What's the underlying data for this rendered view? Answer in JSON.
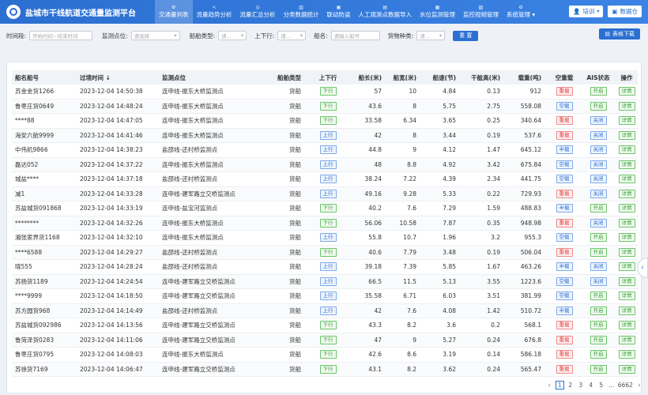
{
  "app": {
    "title": "盐城市干线航道交通量监测平台"
  },
  "nav": [
    {
      "label": "交通量列表",
      "icon": "⚙",
      "active": true
    },
    {
      "label": "流量趋势分析",
      "icon": "<"
    },
    {
      "label": "流量汇总分析",
      "icon": "◎"
    },
    {
      "label": "分类数据统计",
      "icon": "▥"
    },
    {
      "label": "联动防盗",
      "icon": "▣"
    },
    {
      "label": "人工观测点数据导入",
      "icon": "▤"
    },
    {
      "label": "水位监测管理",
      "icon": "▦"
    },
    {
      "label": "监控视频管理",
      "icon": "▧"
    },
    {
      "label": "系统管理 ▾",
      "icon": "⚙"
    }
  ],
  "user": {
    "name": "培训",
    "screen_label": "数据仓"
  },
  "filters": {
    "time_label": "时间段:",
    "time_placeholder": "开始时间~结束时间",
    "point_label": "监测点位:",
    "point_placeholder": "请选择",
    "type_label": "船舶类型:",
    "type_placeholder": "请...",
    "direction_label": "上下行:",
    "direction_placeholder": "请...",
    "ship_label": "船名:",
    "ship_placeholder": "请输入船号",
    "cargo_label": "货物种类:",
    "cargo_placeholder": "请...",
    "reset_label": "重 置",
    "export_label": "表格下载"
  },
  "table": {
    "columns": [
      "船名船号",
      "过境时间 ↓",
      "监测点位",
      "船舶类型",
      "上下行",
      "船长(米)",
      "船宽(米)",
      "船速(节)",
      "干舷高(米)",
      "载重(吨)",
      "空重载",
      "AIS状态",
      "操作"
    ],
    "rows": [
      [
        "苏金金货1266",
        "2023-12-04 14:50:38",
        "连申线-振东大桥监测点",
        "货船",
        "下行",
        "57",
        "10",
        "4.84",
        "0.13",
        "912",
        "重载",
        "开启",
        "详情"
      ],
      [
        "鲁枣庄货0649",
        "2023-12-04 14:48:24",
        "连申线-振东大桥监测点",
        "货船",
        "下行",
        "43.6",
        "8",
        "5.75",
        "2.75",
        "558.08",
        "空载",
        "开启",
        "详情"
      ],
      [
        "****88",
        "2023-12-04 14:47:05",
        "连申线-振东大桥监测点",
        "货船",
        "下行",
        "33.58",
        "6.34",
        "3.65",
        "0.25",
        "340.64",
        "重载",
        "关闭",
        "详情"
      ],
      [
        "海安六航9999",
        "2023-12-04 14:41:46",
        "连申线-振东大桥监测点",
        "货船",
        "上行",
        "42",
        "8",
        "3.44",
        "0.19",
        "537.6",
        "重载",
        "关闭",
        "详情"
      ],
      [
        "中伟机9866",
        "2023-12-04 14:38:23",
        "盐邵线-还村桥监测点",
        "货船",
        "上行",
        "44.8",
        "9",
        "4.12",
        "1.47",
        "645.12",
        "半载",
        "关闭",
        "详情"
      ],
      [
        "磊达052",
        "2023-12-04 14:37:22",
        "连申线-振东大桥监测点",
        "货船",
        "上行",
        "48",
        "8.8",
        "4.92",
        "3.42",
        "675.84",
        "空载",
        "关闭",
        "详情"
      ],
      [
        "城盐****",
        "2023-12-04 14:37:18",
        "盐邵线-还村桥监测点",
        "货船",
        "上行",
        "38.24",
        "7.22",
        "4.39",
        "2.34",
        "441.75",
        "空载",
        "关闭",
        "详情"
      ],
      [
        "减1",
        "2023-12-04 14:33:28",
        "连申线-建军路立交桥监测点",
        "货船",
        "上行",
        "49.16",
        "9.28",
        "5.33",
        "0.22",
        "729.93",
        "重载",
        "关闭",
        "详情"
      ],
      [
        "苏盐城货091868",
        "2023-12-04 14:33:19",
        "连申线-盐宝河监测点",
        "货船",
        "下行",
        "40.2",
        "7.6",
        "7.29",
        "1.59",
        "488.83",
        "半载",
        "开启",
        "详情"
      ],
      [
        "********",
        "2023-12-04 14:32:26",
        "连申线-振东大桥监测点",
        "货船",
        "下行",
        "56.06",
        "10.58",
        "7.87",
        "0.35",
        "948.98",
        "重载",
        "关闭",
        "详情"
      ],
      [
        "湘张家界货1168",
        "2023-12-04 14:32:10",
        "连申线-振东大桥监测点",
        "货船",
        "上行",
        "55.8",
        "10.7",
        "1.96",
        "3.2",
        "955.3",
        "空载",
        "开启",
        "详情"
      ],
      [
        "****6588",
        "2023-12-04 14:29:27",
        "盐邵线-还村桥监测点",
        "货船",
        "下行",
        "40.6",
        "7.79",
        "3.48",
        "0.19",
        "506.04",
        "重载",
        "开启",
        "详情"
      ],
      [
        "晓555",
        "2023-12-04 14:28:24",
        "盐邵线-还村桥监测点",
        "货船",
        "上行",
        "39.18",
        "7.39",
        "5.85",
        "1.67",
        "463.26",
        "半载",
        "关闭",
        "详情"
      ],
      [
        "苏扬货1189",
        "2023-12-04 14:24:54",
        "连申线-建军路立交桥监测点",
        "货船",
        "上行",
        "66.5",
        "11.5",
        "5.13",
        "3.55",
        "1223.6",
        "空载",
        "关闭",
        "详情"
      ],
      [
        "****9999",
        "2023-12-04 14:18:50",
        "连申线-建军路立交桥监测点",
        "货船",
        "上行",
        "35.58",
        "6.71",
        "6.03",
        "3.51",
        "381.99",
        "空载",
        "开启",
        "详情"
      ],
      [
        "苏方圆货968",
        "2023-12-04 14:14:49",
        "盐邵线-还村桥监测点",
        "货船",
        "上行",
        "42",
        "7.6",
        "4.08",
        "1.42",
        "510.72",
        "半载",
        "开启",
        "详情"
      ],
      [
        "苏盐城货092986",
        "2023-12-04 14:13:56",
        "连申线-建军路立交桥监测点",
        "货船",
        "下行",
        "43.3",
        "8.2",
        "3.6",
        "0.2",
        "568.1",
        "重载",
        "开启",
        "详情"
      ],
      [
        "鲁菏泽货0283",
        "2023-12-04 14:11:06",
        "连申线-建军路立交桥监测点",
        "货船",
        "下行",
        "47",
        "9",
        "5.27",
        "0.24",
        "676.8",
        "重载",
        "开启",
        "详情"
      ],
      [
        "鲁枣庄货0795",
        "2023-12-04 14:08:03",
        "连申线-振东大桥监测点",
        "货船",
        "下行",
        "42.6",
        "8.6",
        "3.19",
        "0.14",
        "586.18",
        "重载",
        "开启",
        "详情"
      ],
      [
        "苏徐货7169",
        "2023-12-04 14:06:47",
        "连申线-建军路立交桥监测点",
        "货船",
        "下行",
        "43.1",
        "8.2",
        "3.62",
        "0.24",
        "565.47",
        "重载",
        "开启",
        "详情"
      ]
    ]
  },
  "pagination": {
    "pages": [
      "1",
      "2",
      "3",
      "4",
      "5",
      "...",
      "6662"
    ],
    "current": "1",
    "prev": "‹",
    "next": "›"
  },
  "side_handle": "‹"
}
